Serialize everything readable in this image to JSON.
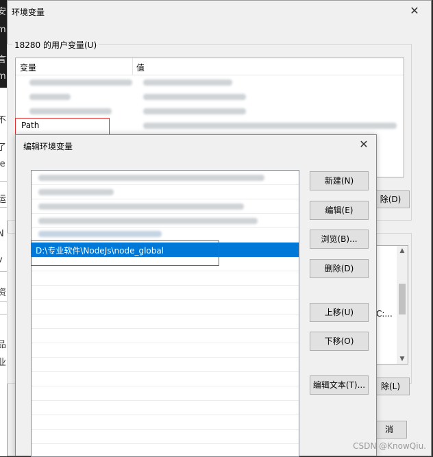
{
  "outer_dialog": {
    "title": "环境变量",
    "user_group_label": "18280 的用户变量(U)",
    "columns": [
      "变量",
      "值"
    ],
    "path_variable": "Path",
    "delete_button_partial": "除(D)",
    "sys_delete_button_partial": "除(L)",
    "sys_value_partial": "C:...",
    "cancel_button_partial": "消"
  },
  "edit_dialog": {
    "title": "编辑环境变量",
    "selected_entry": "D:\\专业软件\\NodeJs\\node_global",
    "buttons": {
      "new": "新建(N)",
      "edit": "编辑(E)",
      "browse": "浏览(B)...",
      "delete": "删除(D)",
      "move_up": "上移(U)",
      "move_down": "下移(O)",
      "edit_text": "编辑文本(T)..."
    }
  },
  "icons": {
    "close": "close-icon",
    "scroll_up": "chevron-up-icon",
    "scroll_down": "chevron-down-icon"
  },
  "colors": {
    "selection": "#0078d7",
    "highlight_box": "#e03030"
  },
  "watermark": "CSDN @KnowQiu."
}
